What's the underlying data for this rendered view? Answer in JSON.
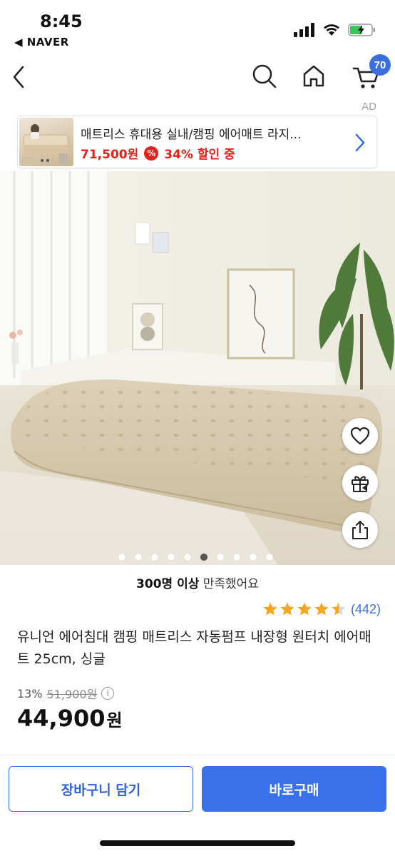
{
  "status_bar": {
    "time": "8:45",
    "back_app": "◀ NAVER",
    "battery_color": "#34c759"
  },
  "nav": {
    "cart_count": "70",
    "accent": "#3b6fe0"
  },
  "ad": {
    "label": "AD",
    "title": "매트리스 휴대용 실내/캠핑 에어매트 라지...",
    "price": "71,500원",
    "percent_icon": "%",
    "discount": "34% 할인 중",
    "price_color": "#e3211b"
  },
  "gallery": {
    "image_count": 10,
    "active_index": 5
  },
  "floating_actions": [
    "heart-icon",
    "gift-icon",
    "share-icon"
  ],
  "product": {
    "satisfaction_bold": "300명 이상",
    "satisfaction_rest": " 만족했어요",
    "rating": 4.5,
    "review_count": "(442)",
    "title": "유니언 에어침대 캠핑 매트리스 자동펌프 내장형 원터치 에어매트 25cm, 싱글",
    "discount_rate": "13%",
    "original_price": "51,900원",
    "info_symbol": "i",
    "price": "44,900",
    "price_unit": "원"
  },
  "actions": {
    "add_to_cart": "장바구니 담기",
    "buy_now": "바로구매",
    "primary_color": "#3871ea"
  }
}
